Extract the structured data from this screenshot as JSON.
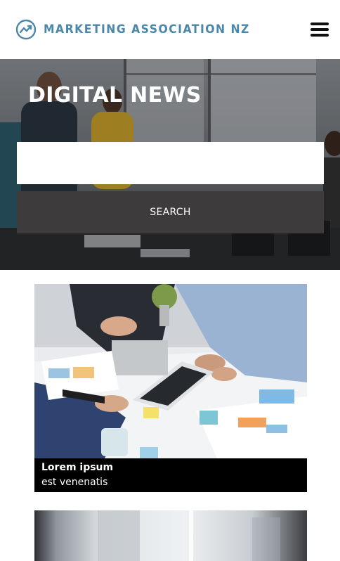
{
  "header": {
    "brand_name": "MARKETING ASSOCIATION NZ",
    "logo_icon": "trending-up-circle-icon",
    "menu_icon": "hamburger-menu-icon",
    "brand_color": "#4a87a8"
  },
  "hero": {
    "title": "DIGITAL NEWS",
    "search": {
      "value": "",
      "placeholder": ""
    },
    "search_button_label": "SEARCH"
  },
  "articles": [
    {
      "title": "Lorem ipsum",
      "excerpt": "est venenatis",
      "image": "business-meeting-documents-photo"
    },
    {
      "title": "",
      "excerpt": "",
      "image": "office-blurred-photo"
    }
  ],
  "colors": {
    "search_button": "#3e3b3d",
    "caption_background": "#000000"
  }
}
